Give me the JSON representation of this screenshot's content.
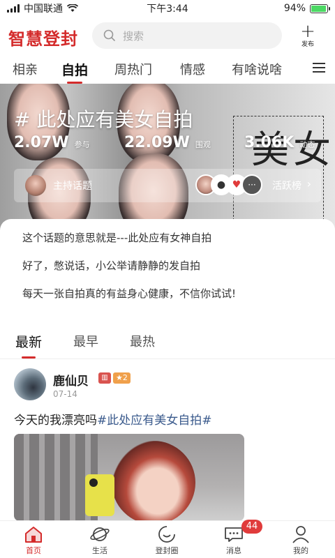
{
  "status_bar": {
    "carrier": "中国联通",
    "time": "下午3:44",
    "battery": "94%",
    "battery_level": 0.94
  },
  "header": {
    "logo": "智慧登封",
    "search_placeholder": "搜索",
    "publish_label": "发布"
  },
  "tabs": [
    {
      "label": "相亲",
      "active": false
    },
    {
      "label": "自拍",
      "active": true
    },
    {
      "label": "周热门",
      "active": false
    },
    {
      "label": "情感",
      "active": false
    },
    {
      "label": "有啥说啥",
      "active": false
    }
  ],
  "banner": {
    "topic": "# 此处应有美女自拍",
    "stats": [
      {
        "value": "2.07W",
        "label": "参与"
      },
      {
        "value": "22.09W",
        "label": "围观"
      },
      {
        "value": "3.06K",
        "label": "动态"
      }
    ],
    "host_label": "主持话题",
    "active_label": "活跃榜",
    "bg_chars": [
      "美",
      "女"
    ]
  },
  "description": [
    "这个话题的意思就是---此处应有女神自拍",
    "好了，憋说话，小公举请静静的发自拍",
    "每天一张自拍真的有益身心健康，不信你试试!"
  ],
  "sort_tabs": [
    {
      "label": "最新",
      "active": true
    },
    {
      "label": "最早",
      "active": false
    },
    {
      "label": "最热",
      "active": false
    }
  ],
  "post": {
    "author": "鹿仙贝",
    "level": "2",
    "date": "07-14",
    "text": "今天的我漂亮吗",
    "hashtag": "#此处应有美女自拍#"
  },
  "bottom_nav": [
    {
      "label": "首页",
      "icon": "home-icon",
      "active": true
    },
    {
      "label": "生活",
      "icon": "planet-icon",
      "active": false
    },
    {
      "label": "登封圈",
      "icon": "smile-icon",
      "active": false
    },
    {
      "label": "消息",
      "icon": "message-icon",
      "active": false,
      "badge": "44"
    },
    {
      "label": "我的",
      "icon": "person-icon",
      "active": false
    }
  ],
  "colors": {
    "brand": "#d42b2b",
    "hashtag": "#3a5a8c",
    "badge": "#e03b3b"
  }
}
